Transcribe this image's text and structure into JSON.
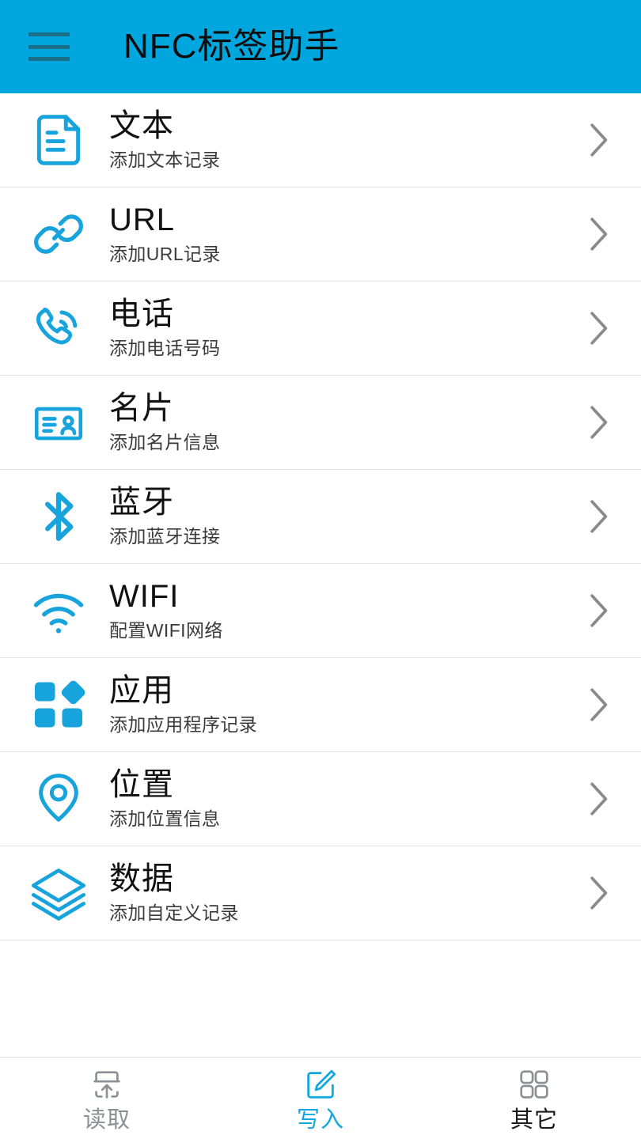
{
  "app": {
    "title": "NFC标签助手",
    "accent_color": "#00A6DE",
    "icon_color": "#17A3DC",
    "menu_icon": "hamburger-menu-icon"
  },
  "list": {
    "items": [
      {
        "title": "文本",
        "subtitle": "添加文本记录",
        "icon": "document-text-icon",
        "chevron": "chevron-right-icon"
      },
      {
        "title": "URL",
        "subtitle": "添加URL记录",
        "icon": "link-chain-icon",
        "chevron": "chevron-right-icon"
      },
      {
        "title": "电话",
        "subtitle": "添加电话号码",
        "icon": "phone-call-icon",
        "chevron": "chevron-right-icon"
      },
      {
        "title": "名片",
        "subtitle": "添加名片信息",
        "icon": "contact-card-icon",
        "chevron": "chevron-right-icon"
      },
      {
        "title": "蓝牙",
        "subtitle": "添加蓝牙连接",
        "icon": "bluetooth-icon",
        "chevron": "chevron-right-icon"
      },
      {
        "title": "WIFI",
        "subtitle": "配置WIFI网络",
        "icon": "wifi-icon",
        "chevron": "chevron-right-icon"
      },
      {
        "title": "应用",
        "subtitle": "添加应用程序记录",
        "icon": "apps-grid-icon",
        "chevron": "chevron-right-icon"
      },
      {
        "title": "位置",
        "subtitle": "添加位置信息",
        "icon": "location-pin-icon",
        "chevron": "chevron-right-icon"
      },
      {
        "title": "数据",
        "subtitle": "添加自定义记录",
        "icon": "layers-stack-icon",
        "chevron": "chevron-right-icon"
      }
    ]
  },
  "tabbar": {
    "active": "写入",
    "tabs": [
      {
        "label": "读取",
        "icon": "tag-read-arrow-up-icon",
        "color": "#8b9094"
      },
      {
        "label": "写入",
        "icon": "pencil-edit-square-icon",
        "color": "#12A7E0"
      },
      {
        "label": "其它",
        "icon": "grid-four-squares-icon",
        "color": "#1a1a1a"
      }
    ]
  }
}
